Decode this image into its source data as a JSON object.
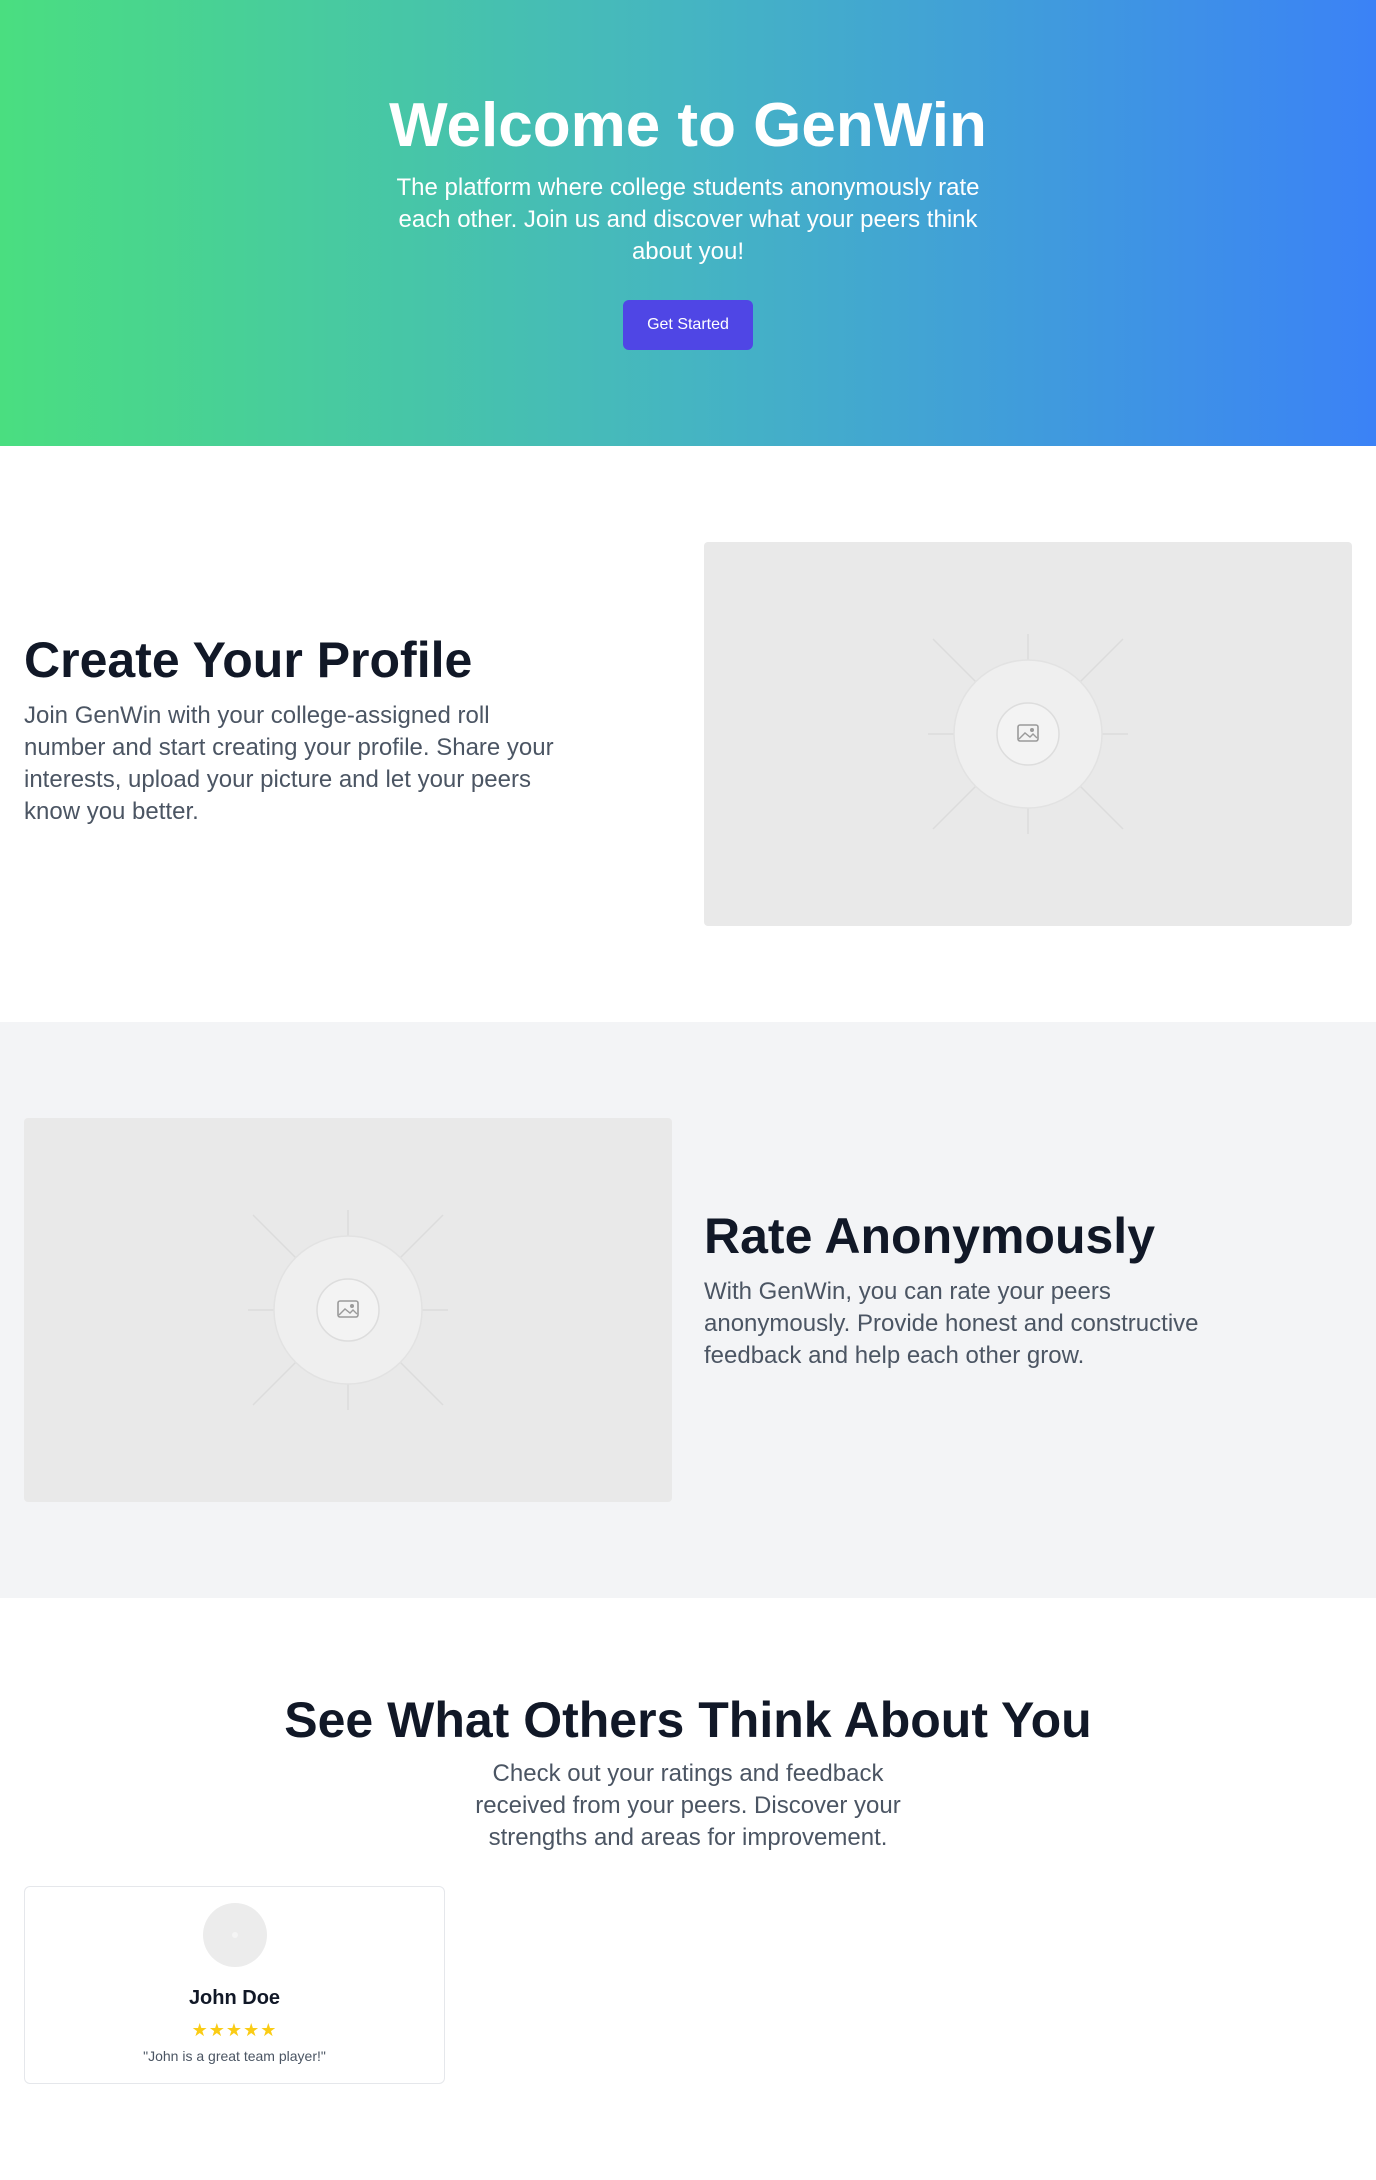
{
  "hero": {
    "title": "Welcome to GenWin",
    "subtitle": "The platform where college students anonymously rate each other. Join us and discover what your peers think about you!",
    "cta_label": "Get Started",
    "gradient_start": "#4ade80",
    "gradient_end": "#3b82f6",
    "button_color": "#4f46e5"
  },
  "features": [
    {
      "title": "Create Your Profile",
      "text": "Join GenWin with your college-assigned roll number and start creating your profile. Share your interests, upload your picture and let your peers know you better.",
      "image_icon": "image-placeholder-icon"
    },
    {
      "title": "Rate Anonymously",
      "text": "With GenWin, you can rate your peers anonymously. Provide honest and constructive feedback and help each other grow.",
      "image_icon": "image-placeholder-icon"
    }
  ],
  "ratings_section": {
    "title": "See What Others Think About You",
    "subtitle": "Check out your ratings and feedback received from your peers. Discover your strengths and areas for improvement.",
    "cards": [
      {
        "name": "John Doe",
        "stars": "★★★★★",
        "rating": 5,
        "quote": "\"John is a great team player!\""
      }
    ]
  },
  "colors": {
    "heading": "#111827",
    "body_text": "#4b5563",
    "alt_section_bg": "#f3f4f6",
    "star": "#facc15"
  }
}
